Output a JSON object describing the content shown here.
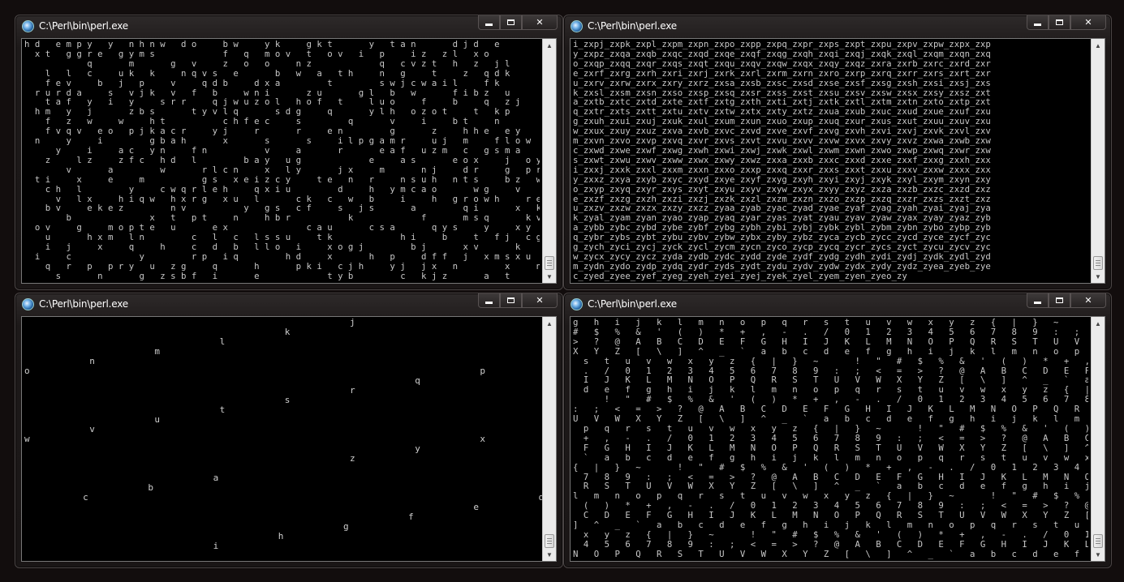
{
  "windows": {
    "tl": {
      "title": "C:\\Perl\\bin\\perl.exe",
      "text": "h d   e m p y   y   n h n w   d o     b w     y k     g k t       y   t a n       d j d   e\n  x t   g g r e   g y m s             f   q   m o v   t   o v   i   p     i z   z l   x o\n            q       m       g   v     z   o   o     n z             q   c v z t   h   z   j l\n    l   l   c     u k   k     n q v s   e       b   w   a   t h     n   g     t     z   q d k\n    f e v     b   j   p     v     q d b     d x a         t         s w j c w a i l     f k\n  r u r d a     s   v j k   v   f   b     w n i       z u       g l   b   w       f i b z   u\n    t a f   y   i   y     s r r     q j w u z o l   h o f   t     l u o     f     b     q   z j\n  h m   y   j       z b s       t y v l q       s d g     q       y l h   o z o t     t   k p\n    f   z   w     w     h t           c h f e c     s         q       v     i     b t     n\n    f v q v   e o   p j k a c r     y j     r       r     e n         g       z     h h e   e y\n  n     y     i         g b a h       x       s       s     i l p g a m r     u j   m     f l o w\n      y     i     a c   y n     f n           v     a       r       e a f   u z m   c   g s m a     v p w\n    z     l z     z f c   h d   l         b a y   u g             e     a s       e o x     j   o y l c l p\n        v       a         w       r l c n     x   l y       j x     m       n j     d r     g   p r u i\n  t i     x     e     m           g s   x e i z c y     t e   n   r     n s u h   n t s     b z   w b\n    c h   l         y     c w q r l e h     q x i u         d     h   y m c a o       w g     v     v\n      v   l x     h i q w   h x r g   x u   l       c k   c   w   b     i     h   g r o w h     r e d j\n    b v     e k e z         n v           y   g s   c f     s   j s       a         q i       x   k     v\n        b               x   t   p t     n     h b r           k             f       m s q       k v     t\n  o v     g     m o p t e   u       e x               c a u       c s a       q y s     y     x y     p\n    u       h x m   l n         c   l   c   l s s u     t k             h i     b     t   f j   c g c\n    i   j     x     q     h     c   d   b   l l o   i     x o g j         b j       x v       k     f e u\n  i     c             y         r p   i q         h d     x       h   p     d f f   j   x m s x u   j       r\n    q   r   p   p r y   u   z g     q       h       p k i   c j h     y j   j x   n         x     n v   t b k\n      s       n       g   z s b f   i       e             t y b         c   k j z       a   t           j   x   r"
    },
    "tr": {
      "title": "C:\\Perl\\bin\\perl.exe",
      "text": "i_zxpj_zxpk_zxpl_zxpm_zxpn_zxpo_zxpp_zxpq_zxpr_zxps_zxpt_zxpu_zxpv_zxpw_zxpx_zxp\ny_zxpz_zxqa_zxqb_zxqc_zxqd_zxqe_zxqf_zxqg_zxqh_zxqi_zxqj_zxqk_zxql_zxqm_zxqn_zxq\no_zxqp_zxqq_zxqr_zxqs_zxqt_zxqu_zxqv_zxqw_zxqx_zxqy_zxqz_zxra_zxrb_zxrc_zxrd_zxr\ne_zxrf_zxrg_zxrh_zxri_zxrj_zxrk_zxrl_zxrm_zxrn_zxro_zxrp_zxrq_zxrr_zxrs_zxrt_zxr\nu_zxrv_zxrw_zxrx_zxry_zxrz_zxsa_zxsb_zxsc_zxsd_zxse_zxsf_zxsg_zxsh_zxsi_zxsj_zxs\nk_zxsl_zxsm_zxsn_zxso_zxsp_zxsq_zxsr_zxss_zxst_zxsu_zxsv_zxsw_zxsx_zxsy_zxsz_zxt\na_zxtb_zxtc_zxtd_zxte_zxtf_zxtg_zxth_zxti_zxtj_zxtk_zxtl_zxtm_zxtn_zxto_zxtp_zxt\nq_zxtr_zxts_zxtt_zxtu_zxtv_zxtw_zxtx_zxty_zxtz_zxua_zxub_zxuc_zxud_zxue_zxuf_zxu\ng_zxuh_zxui_zxuj_zxuk_zxul_zxum_zxun_zxuo_zxup_zxuq_zxur_zxus_zxut_zxuu_zxuv_zxu\nw_zxux_zxuy_zxuz_zxva_zxvb_zxvc_zxvd_zxve_zxvf_zxvg_zxvh_zxvi_zxvj_zxvk_zxvl_zxv\nm_zxvn_zxvo_zxvp_zxvq_zxvr_zxvs_zxvt_zxvu_zxvv_zxvw_zxvx_zxvy_zxvz_zxwa_zxwb_zxw\nc_zxwd_zxwe_zxwf_zxwg_zxwh_zxwi_zxwj_zxwk_zxwl_zxwm_zxwn_zxwo_zxwp_zxwq_zxwr_zxw\ns_zxwt_zxwu_zxwv_zxww_zxwx_zxwy_zxwz_zxxa_zxxb_zxxc_zxxd_zxxe_zxxf_zxxg_zxxh_zxx\ni_zxxj_zxxk_zxxl_zxxm_zxxn_zxxo_zxxp_zxxq_zxxr_zxxs_zxxt_zxxu_zxxv_zxxw_zxxx_zxx\ny_zxxz_zxya_zxyb_zxyc_zxyd_zxye_zxyf_zxyg_zxyh_zxyi_zxyj_zxyk_zxyl_zxym_zxyn_zxy\no_zxyp_zxyq_zxyr_zxys_zxyt_zxyu_zxyv_zxyw_zxyx_zxyy_zxyz_zxza_zxzb_zxzc_zxzd_zxz\ne_zxzf_zxzg_zxzh_zxzi_zxzj_zxzk_zxzl_zxzm_zxzn_zxzo_zxzp_zxzq_zxzr_zxzs_zxzt_zxz\nu_zxzv_zxzw_zxzx_zxzy_zxzz_zyaa_zyab_zyac_zyad_zyae_zyaf_zyag_zyah_zyai_zyaj_zya\nk_zyal_zyam_zyan_zyao_zyap_zyaq_zyar_zyas_zyat_zyau_zyav_zyaw_zyax_zyay_zyaz_zyb\na_zybb_zybc_zybd_zybe_zybf_zybg_zybh_zybi_zybj_zybk_zybl_zybm_zybn_zybo_zybp_zyb\nq_zybr_zybs_zybt_zybu_zybv_zybw_zybx_zyby_zybz_zyca_zycb_zycc_zycd_zyce_zycf_zyc\ng_zych_zyci_zycj_zyck_zycl_zycm_zycn_zyco_zycp_zycq_zycr_zycs_zyct_zycu_zycv_zyc\nw_zycx_zycy_zycz_zyda_zydb_zydc_zydd_zyde_zydf_zydg_zydh_zydi_zydj_zydk_zydl_zyd\nm_zydn_zydo_zydp_zydq_zydr_zyds_zydt_zydu_zydv_zydw_zydx_zydy_zydz_zyea_zyeb_zye\nc_zyed_zyee_zyef_zyeg_zyeh_zyei_zyej_zyek_zyel_zyem_zyen_zyeo_zy"
    },
    "bl": {
      "title": "C:\\Perl\\bin\\perl.exe",
      "letters": [
        {
          "ch": "j",
          "c": 50,
          "r": 0
        },
        {
          "ch": "k",
          "c": 40,
          "r": 1
        },
        {
          "ch": "l",
          "c": 30,
          "r": 2
        },
        {
          "ch": "m",
          "c": 20,
          "r": 3
        },
        {
          "ch": "n",
          "c": 10,
          "r": 4
        },
        {
          "ch": "o",
          "c": 0,
          "r": 5
        },
        {
          "ch": "p",
          "c": 70,
          "r": 5
        },
        {
          "ch": "q",
          "c": 60,
          "r": 6
        },
        {
          "ch": "r",
          "c": 50,
          "r": 7
        },
        {
          "ch": "s",
          "c": 40,
          "r": 8
        },
        {
          "ch": "t",
          "c": 30,
          "r": 9
        },
        {
          "ch": "u",
          "c": 20,
          "r": 10
        },
        {
          "ch": "v",
          "c": 10,
          "r": 11
        },
        {
          "ch": "w",
          "c": 0,
          "r": 12
        },
        {
          "ch": "x",
          "c": 70,
          "r": 12
        },
        {
          "ch": "y",
          "c": 60,
          "r": 13
        },
        {
          "ch": "z",
          "c": 50,
          "r": 14
        },
        {
          "ch": "a",
          "c": 29,
          "r": 16
        },
        {
          "ch": "b",
          "c": 19,
          "r": 17
        },
        {
          "ch": "c",
          "c": 9,
          "r": 18
        },
        {
          "ch": "d",
          "c": 79,
          "r": 18
        },
        {
          "ch": "e",
          "c": 69,
          "r": 19
        },
        {
          "ch": "f",
          "c": 59,
          "r": 20
        },
        {
          "ch": "g",
          "c": 49,
          "r": 21
        },
        {
          "ch": "h",
          "c": 39,
          "r": 22
        },
        {
          "ch": "i",
          "c": 29,
          "r": 23
        }
      ]
    },
    "br": {
      "title": "C:\\Perl\\bin\\perl.exe",
      "text": "g   h   i   j   k   l   m   n   o   p   q   r   s   t   u   v   w   x   y   z   {   |   }   ~       !   \"   \n#   $   %   &   '   (   )   *   +   ,   -   .   /   0   1   2   3   4   5   6   7   8   9   :   ;   <   =   \n>   ?   @   A   B   C   D   E   F   G   H   I   J   K   L   M   N   O   P   Q   R   S   T   U   V   W   \nX   Y   Z   [   \\   ]   ^   _   `   a   b   c   d   e   f   g   h   i   j   k   l   m   n   o   p   q   r   \n  s   t   u   v   w   x   y   z   {   |   }   ~       !   \"   #   $   %   &   '   (   )   *   +   ,   -   \n  .   /   0   1   2   3   4   5   6   7   8   9   :   ;   <   =   >   ?   @   A   B   C   D   E   F   G   H   \n  I   J   K   L   M   N   O   P   Q   R   S   T   U   V   W   X   Y   Z   [   \\   ]   ^   _   `   a   b   c   \n  d   e   f   g   h   i   j   k   l   m   n   o   p   q   r   s   t   u   v   w   x   y   z   {   |   }   ~   \n      !   \"   #   $   %   &   '   (   )   *   +   ,   -   .   /   0   1   2   3   4   5   6   7   8   9   \n:   ;   <   =   >   ?   @   A   B   C   D   E   F   G   H   I   J   K   L   M   N   O   P   Q   R   S   T   \nU   V   W   X   Y   Z   [   \\   ]   ^   _   `   a   b   c   d   e   f   g   h   i   j   k   l   m   n   o   \n  p   q   r   s   t   u   v   w   x   y   z   {   |   }   ~       !   \"   #   $   %   &   '   (   )   *   \n  +   ,   -   .   /   0   1   2   3   4   5   6   7   8   9   :   ;   <   =   >   ?   @   A   B   C   D   E   \n  F   G   H   I   J   K   L   M   N   O   P   Q   R   S   T   U   V   W   X   Y   Z   [   \\   ]   ^   _   \n  `   a   b   c   d   e   f   g   h   i   j   k   l   m   n   o   p   q   r   s   t   u   v   w   x   y   z   \n{   |   }   ~       !   \"   #   $   %   &   '   (   )   *   +   ,   -   .   /   0   1   2   3   4   5   6   \n  7   8   9   :   ;   <   =   >   ?   @   A   B   C   D   E   F   G   H   I   J   K   L   M   N   O   P   Q   \n  R   S   T   U   V   W   X   Y   Z   [   \\   ]   ^   _   `   a   b   c   d   e   f   g   h   i   j   k   \nl   m   n   o   p   q   r   s   t   u   v   w   x   y   z   {   |   }   ~       !   \"   #   $   %   &   '   \n  (   )   *   +   ,   -   .   /   0   1   2   3   4   5   6   7   8   9   :   ;   <   =   >   ?   @   A   B   \n  C   D   E   F   G   H   I   J   K   L   M   N   O   P   Q   R   S   T   U   V   W   X   Y   Z   [   \\   \n]   ^   _   `   a   b   c   d   e   f   g   h   i   j   k   l   m   n   o   p   q   r   s   t   u   v   w   \n  x   y   z   {   |   }   ~       !   \"   #   $   %   &   '   (   )   *   +   ,   -   .   /   0   1   2   3   \n  4   5   6   7   8   9   :   ;   <   =   >   ?   @   A   B   C   D   E   F   G   H   I   J   K   L   M   \nN   O   P   Q   R   S   T   U   V   W   X   Y   Z   [   \\   ]   ^   _   `   a   b   c   d   e   f   g   h   "
    }
  },
  "icons": {
    "app": "perl-app-icon",
    "minimize": "minimize-icon",
    "maximize": "maximize-icon",
    "close": "close-icon",
    "scroll_up": "scroll-up-arrow-icon",
    "scroll_down": "scroll-down-arrow-icon"
  }
}
